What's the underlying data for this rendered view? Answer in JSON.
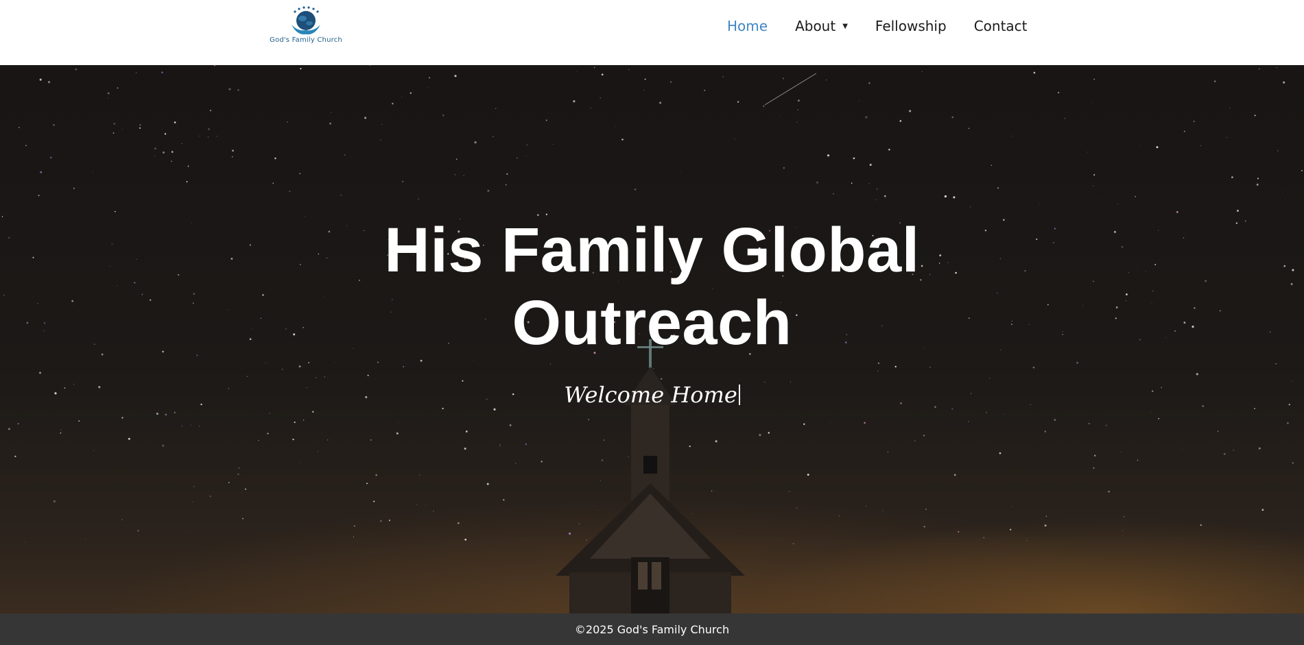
{
  "header": {
    "logo_text": "God's Family Church",
    "nav": [
      {
        "label": "Home",
        "active": true
      },
      {
        "label": "About",
        "has_dropdown": true
      },
      {
        "label": "Fellowship"
      },
      {
        "label": "Contact"
      }
    ]
  },
  "hero": {
    "title_line1": "His Family Global",
    "title_line2": "Outreach",
    "subtitle": "Welcome Home"
  },
  "footer": {
    "copyright": "©2025 God's Family Church"
  },
  "colors": {
    "accent": "#3f86c4",
    "footer_bg": "#363636",
    "logo_blue": "#1f5f8a"
  },
  "icons": {
    "logo": "globe-hands-logo-icon",
    "dropdown": "caret-down-icon"
  }
}
